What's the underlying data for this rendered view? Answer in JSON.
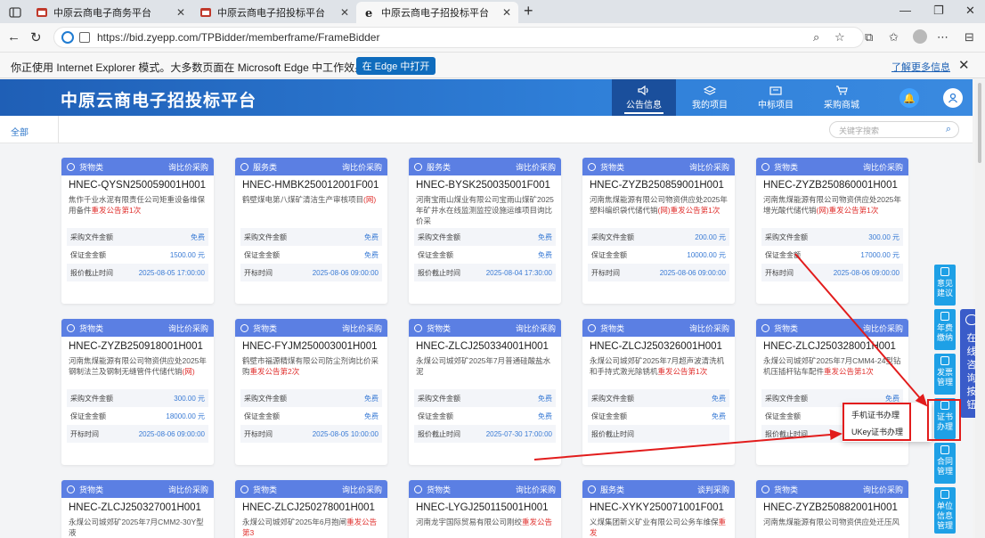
{
  "browser": {
    "tabs": [
      {
        "label": "中原云商电子商务平台"
      },
      {
        "label": "中原云商电子招投标平台"
      },
      {
        "label": "中原云商电子招投标平台"
      }
    ],
    "url": "https://bid.zyepp.com/TPBidder/memberframe/FrameBidder",
    "ie_notice": {
      "message": "你正使用 Internet Explorer 模式。大多数页面在 Microsoft Edge 中工作效果更佳。",
      "button": "在 Edge 中打开",
      "link": "了解更多信息"
    }
  },
  "site": {
    "title": "中原云商电子招投标平台",
    "nav": [
      {
        "label": "公告信息",
        "icon": "speaker-icon",
        "active": true
      },
      {
        "label": "我的项目",
        "icon": "layers-icon",
        "active": false
      },
      {
        "label": "中标项目",
        "icon": "folder-icon",
        "active": false
      },
      {
        "label": "采购商城",
        "icon": "cart-icon",
        "active": false
      }
    ],
    "filter_all": "全部",
    "search_placeholder": "关键字搜索"
  },
  "cards": [
    {
      "cat": "货物类",
      "method": "询比价采购",
      "code": "HNEC-QYSN250059001H001",
      "desc": "焦作千业水泥有限责任公司矩重设备维保用备件",
      "desc_red": "重发公告第1次",
      "r1": "采购文件金额",
      "v1": "免费",
      "r2": "保证金金额",
      "v2": "1500.00 元",
      "r3": "报价截止时间",
      "v3": "2025-08-05 17:00:00"
    },
    {
      "cat": "服务类",
      "method": "询比价采购",
      "code": "HNEC-HMBK250012001F001",
      "desc": "鹤壁煤电第八煤矿清洁生产审核项目",
      "desc_red": "(网)",
      "r1": "采购文件金额",
      "v1": "免费",
      "r2": "保证金金额",
      "v2": "免费",
      "r3": "开标时间",
      "v3": "2025-08-06 09:00:00"
    },
    {
      "cat": "服务类",
      "method": "询比价采购",
      "code": "HNEC-BYSK250035001F001",
      "desc": "河南宝雨山煤业有限公司宝雨山煤矿2025年矿井水在线监测监控设施运维项目询比价采",
      "desc_red": "",
      "r1": "采购文件金额",
      "v1": "免费",
      "r2": "保证金金额",
      "v2": "免费",
      "r3": "报价截止时间",
      "v3": "2025-08-04 17:30:00"
    },
    {
      "cat": "货物类",
      "method": "询比价采购",
      "code": "HNEC-ZYZB250859001H001",
      "desc": "河南焦煤能源有限公司物资供应处2025年塑料编织袋代储代销",
      "desc_red": "(网)重发公告第1次",
      "r1": "采购文件金额",
      "v1": "200.00 元",
      "r2": "保证金金额",
      "v2": "10000.00 元",
      "r3": "开标时间",
      "v3": "2025-08-06 09:00:00"
    },
    {
      "cat": "货物类",
      "method": "询比价采购",
      "code": "HNEC-ZYZB250860001H001",
      "desc": "河南焦煤能源有限公司物资供应处2025年增光酸代储代销",
      "desc_red": "(网)重发公告第1次",
      "r1": "采购文件金额",
      "v1": "300.00 元",
      "r2": "保证金金额",
      "v2": "17000.00 元",
      "r3": "开标时间",
      "v3": "2025-08-06 09:00:00"
    },
    {
      "cat": "货物类",
      "method": "询比价采购",
      "code": "HNEC-ZYZB250918001H001",
      "desc": "河南焦煤能源有限公司物资供应处2025年钢制法兰及钢制无缝管件代储代销",
      "desc_red": "(网)",
      "r1": "采购文件金额",
      "v1": "300.00 元",
      "r2": "保证金金额",
      "v2": "18000.00 元",
      "r3": "开标时间",
      "v3": "2025-08-06 09:00:00"
    },
    {
      "cat": "货物类",
      "method": "询比价采购",
      "code": "HNEC-FYJM250003001H001",
      "desc": "鹤壁市福源精煤有限公司防尘剂询比价采购",
      "desc_red": "重发公告第2次",
      "r1": "采购文件金额",
      "v1": "免费",
      "r2": "保证金金额",
      "v2": "免费",
      "r3": "开标时间",
      "v3": "2025-08-05 10:00:00"
    },
    {
      "cat": "货物类",
      "method": "询比价采购",
      "code": "HNEC-ZLCJ250334001H001",
      "desc": "永煤公司城郊矿2025年7月普通硅酸盐水泥",
      "desc_red": "",
      "r1": "采购文件金额",
      "v1": "免费",
      "r2": "保证金金额",
      "v2": "免费",
      "r3": "报价截止时间",
      "v3": "2025-07-30 17:00:00"
    },
    {
      "cat": "货物类",
      "method": "询比价采购",
      "code": "HNEC-ZLCJ250326001H001",
      "desc": "永煤公司城郊矿2025年7月超声波清洗机和手持式激光除锈机",
      "desc_red": "重发公告第1次",
      "r1": "采购文件金额",
      "v1": "免费",
      "r2": "保证金金额",
      "v2": "免费",
      "r3": "报价截止时间",
      "v3": ""
    },
    {
      "cat": "货物类",
      "method": "询比价采购",
      "code": "HNEC-ZLCJ250328001H001",
      "desc": "永煤公司城郊矿2025年7月CMM4-24型钻机压插杆钻车配件",
      "desc_red": "重发公告第1次",
      "r1": "采购文件金额",
      "v1": "免费",
      "r2": "保证金金额",
      "v2": "免费",
      "r3": "报价截止时间",
      "v3": ""
    },
    {
      "cat": "货物类",
      "method": "询比价采购",
      "code": "HNEC-ZLCJ250327001H001",
      "desc": "永煤公司城郊矿2025年7月CMM2-30Y型液",
      "desc_red": "",
      "r1": "",
      "v1": "",
      "r2": "",
      "v2": "",
      "r3": "",
      "v3": ""
    },
    {
      "cat": "货物类",
      "method": "询比价采购",
      "code": "HNEC-ZLCJ250278001H001",
      "desc": "永煤公司城郊矿2025年6月抱闸",
      "desc_red": "重发公告第3",
      "r1": "",
      "v1": "",
      "r2": "",
      "v2": "",
      "r3": "",
      "v3": ""
    },
    {
      "cat": "货物类",
      "method": "询比价采购",
      "code": "HNEC-LYGJ250115001H001",
      "desc": "河南龙宇国际贸易有限公司刚绞",
      "desc_red": "重发公告",
      "r1": "",
      "v1": "",
      "r2": "",
      "v2": "",
      "r3": "",
      "v3": ""
    },
    {
      "cat": "服务类",
      "method": "谈判采购",
      "code": "HNEC-XYKY250071001F001",
      "desc": "义煤集团新义矿业有限公司公务车维保",
      "desc_red": "重发",
      "r1": "",
      "v1": "",
      "r2": "",
      "v2": "",
      "r3": "",
      "v3": ""
    },
    {
      "cat": "货物类",
      "method": "询比价采购",
      "code": "HNEC-ZYZB250882001H001",
      "desc": "河南焦煤能源有限公司物资供应处迁压风",
      "desc_red": "",
      "r1": "",
      "v1": "",
      "r2": "",
      "v2": "",
      "r3": "",
      "v3": ""
    }
  ],
  "tools": [
    {
      "label": "意见建议"
    },
    {
      "label": "年费缴纳"
    },
    {
      "label": "发票管理"
    },
    {
      "label": "证书办理"
    },
    {
      "label": "合同管理"
    },
    {
      "label": "单位信息管理"
    }
  ],
  "consult": "在线咨询按钮",
  "popup": [
    "手机证书办理",
    "UKey证书办理"
  ],
  "colors": {
    "header": "#2f7fd8",
    "card_head": "#5b7fe3",
    "highlight": "#e21c1c",
    "tool": "#1ea0e6"
  }
}
